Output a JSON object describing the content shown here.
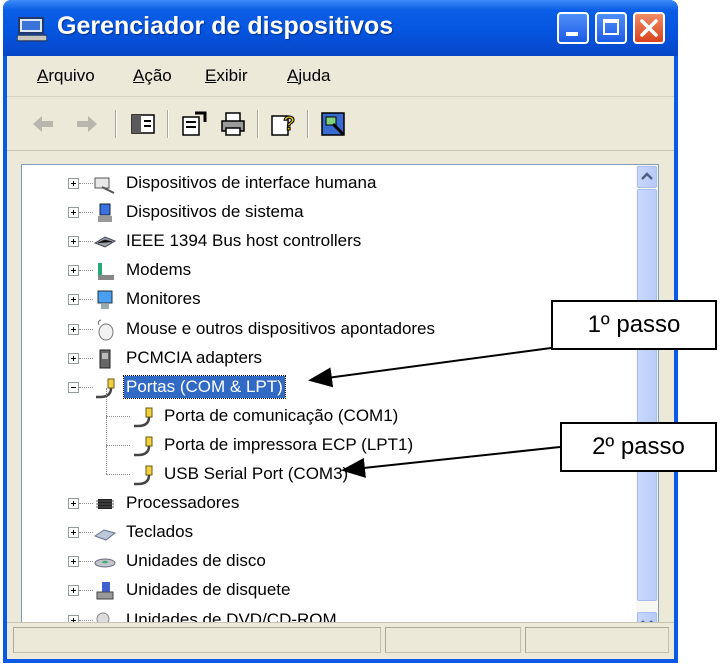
{
  "window": {
    "title": "Gerenciador de dispositivos",
    "icon": "computer-icon"
  },
  "titlebar_buttons": [
    "minimize-icon",
    "maximize-icon",
    "close-icon"
  ],
  "menu": [
    "Arquivo",
    "Ação",
    "Exibir",
    "Ajuda"
  ],
  "toolbar": [
    "back-arrow-icon",
    "forward-arrow-icon",
    "console-tree-icon",
    "properties-icon",
    "print-icon",
    "help-icon",
    "scan-hardware-icon"
  ],
  "tree": {
    "items": [
      {
        "label": "Dispositivos de interface humana",
        "icon": "hid-icon",
        "expander": "+"
      },
      {
        "label": "Dispositivos de sistema",
        "icon": "system-device-icon",
        "expander": "+"
      },
      {
        "label": "IEEE 1394 Bus host controllers",
        "icon": "firewire-icon",
        "expander": "+"
      },
      {
        "label": "Modems",
        "icon": "modem-icon",
        "expander": "+"
      },
      {
        "label": "Monitores",
        "icon": "monitor-icon",
        "expander": "+"
      },
      {
        "label": "Mouse e outros dispositivos apontadores",
        "icon": "mouse-icon",
        "expander": "+"
      },
      {
        "label": "PCMCIA adapters",
        "icon": "pcmcia-icon",
        "expander": "+"
      },
      {
        "label": "Portas (COM & LPT)",
        "icon": "port-icon",
        "expander": "-",
        "selected": true
      },
      {
        "label": "Porta de comunicação (COM1)",
        "icon": "port-icon",
        "child": true
      },
      {
        "label": "Porta de impressora ECP (LPT1)",
        "icon": "port-icon",
        "child": true
      },
      {
        "label": "USB Serial Port (COM3)",
        "icon": "port-icon",
        "child": true
      },
      {
        "label": "Processadores",
        "icon": "processor-icon",
        "expander": "+"
      },
      {
        "label": "Teclados",
        "icon": "keyboard-icon",
        "expander": "+"
      },
      {
        "label": "Unidades de disco",
        "icon": "disk-icon",
        "expander": "+"
      },
      {
        "label": "Unidades de disquete",
        "icon": "floppy-icon",
        "expander": "+"
      },
      {
        "label": "Unidades de DVD/CD-ROM",
        "icon": "cdrom-icon",
        "expander": "+"
      }
    ]
  },
  "callouts": {
    "step1": "1º passo",
    "step2": "2º passo"
  },
  "colors": {
    "titlebar": "#0555e0",
    "selection": "#316ac5",
    "close_button": "#d8431c"
  }
}
